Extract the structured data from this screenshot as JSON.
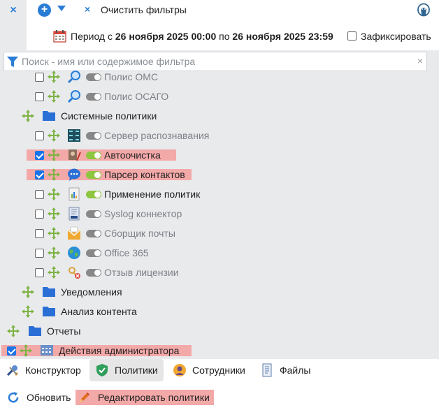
{
  "toolbar": {
    "close_label": "×",
    "add_label": "+",
    "clear_filters_label": "Очистить фильтры"
  },
  "period": {
    "prefix": "Период с ",
    "from": "26 ноября 2025 00:00",
    "mid": " по ",
    "to": "26 ноября 2025 23:59",
    "fix_label": "Зафиксировать",
    "fix_checked": false
  },
  "search": {
    "placeholder": "Поиск - имя или содержимое фильтра",
    "clear_label": "×"
  },
  "tree": [
    {
      "label": "Полис ОМС",
      "checked": false,
      "toggle": "off",
      "dim": true
    },
    {
      "label": "Полис ОСАГО",
      "checked": false,
      "toggle": "off",
      "dim": true
    },
    {
      "label": "Системные политики",
      "type": "folder"
    },
    {
      "label": "Сервер распознавания",
      "checked": false,
      "toggle": "off",
      "dim": true
    },
    {
      "label": "Автоочистка",
      "checked": true,
      "toggle": "on",
      "highlighted": true
    },
    {
      "label": "Парсер контактов",
      "checked": true,
      "toggle": "on",
      "highlighted": true
    },
    {
      "label": "Применение политик",
      "checked": false,
      "toggle": "on"
    },
    {
      "label": "Syslog коннектор",
      "checked": false,
      "toggle": "off",
      "dim": true
    },
    {
      "label": "Сборщик почты",
      "checked": false,
      "toggle": "off",
      "dim": true
    },
    {
      "label": "Office 365",
      "checked": false,
      "toggle": "off",
      "dim": true
    },
    {
      "label": "Отзыв лицензии",
      "checked": false,
      "toggle": "off",
      "dim": true
    },
    {
      "label": "Уведомления",
      "type": "folder"
    },
    {
      "label": "Анализ контента",
      "type": "folder"
    },
    {
      "label": "Отчеты",
      "type": "folder"
    },
    {
      "label": "Действия администратора",
      "checked": true,
      "type": "folder",
      "highlighted": true
    }
  ],
  "tabs": [
    {
      "label": "Конструктор",
      "icon": "wrench-icon"
    },
    {
      "label": "Политики",
      "icon": "shield-icon",
      "active": true
    },
    {
      "label": "Сотрудники",
      "icon": "user-icon"
    },
    {
      "label": "Файлы",
      "icon": "file-icon"
    }
  ],
  "actions": {
    "refresh_label": "Обновить",
    "edit_label": "Редактировать политики"
  },
  "colors": {
    "accent": "#2a7dd6",
    "highlight": "#f4a9a9",
    "toggle_on": "#8dc63f",
    "panel_bg": "#e9eaec"
  }
}
